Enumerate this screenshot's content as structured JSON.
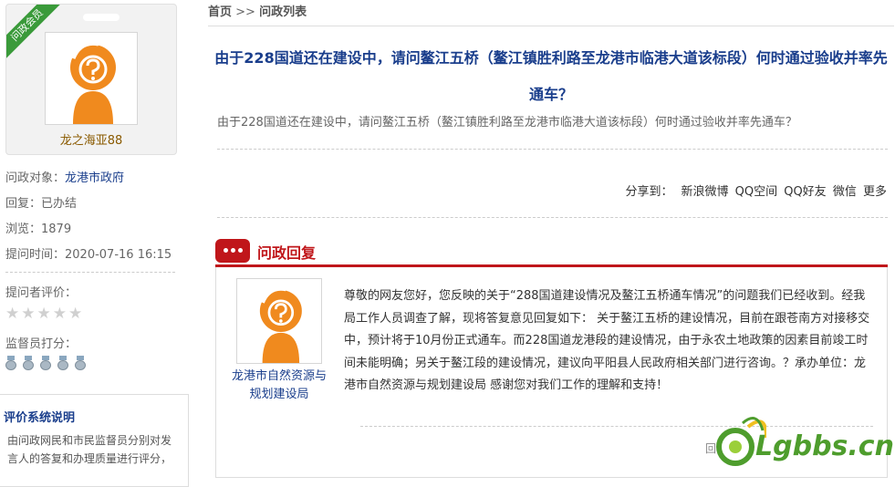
{
  "sidebar": {
    "badge": "问政会员",
    "username": "龙之海亚88",
    "target_label": "问政对象：",
    "target_value": "龙港市政府",
    "reply_label": "回复：",
    "reply_value": "已办结",
    "views_label": "浏览：",
    "views_value": "1879",
    "time_label": "提问时间：",
    "time_value": "2020-07-16 16:15",
    "asker_rating_label": "提问者评价：",
    "supervisor_rating_label": "监督员打分：",
    "eval_title": "评价系统说明",
    "eval_text": "由问政网民和市民监督员分别对发言人的答复和办理质量进行评分，"
  },
  "breadcrumb": {
    "home": "首页",
    "sep": ">>",
    "current": "问政列表"
  },
  "question": {
    "title": "由于228国道还在建设中，请问鳌江五桥（鳌江镇胜利路至龙港市临港大道该标段）何时通过验收并率先通车？",
    "body": "由于228国道还在建设中，请问鳌江五桥（鳌江镇胜利路至龙港市临港大道该标段）何时通过验收并率先通车？"
  },
  "share": {
    "label": "分享到：",
    "items": [
      "新浪微博",
      "QQ空间",
      "QQ好友",
      "微信",
      "更多"
    ]
  },
  "reply": {
    "section_title": "问政回复",
    "org_name": "龙港市自然资源与规划建设局",
    "text": "尊敬的网友您好，您反映的关于“288国道建设情况及鳌江五桥通车情况”的问题我们已经收到。经我局工作人员调查了解，现将答复意见回复如下： 关于鳌江五桥的建设情况，目前在跟苍南方对接移交中，预计将于10月份正式通车。而228国道龙港段的建设情况，由于永农土地政策的因素目前竣工时间未能明确；另关于鳌江段的建设情况，建议向平阳县人民政府相关部门进行咨询。？承办单位：龙港市自然资源与规划建设局 感谢您对我们工作的理解和支持！",
    "tail": "回"
  },
  "watermark": "Lgbbs.cn",
  "colors": {
    "accent_red": "#c0161a",
    "link_blue": "#1a3e8c",
    "avatar_orange": "#f08a1e",
    "badge_green": "#3a9a3a"
  }
}
